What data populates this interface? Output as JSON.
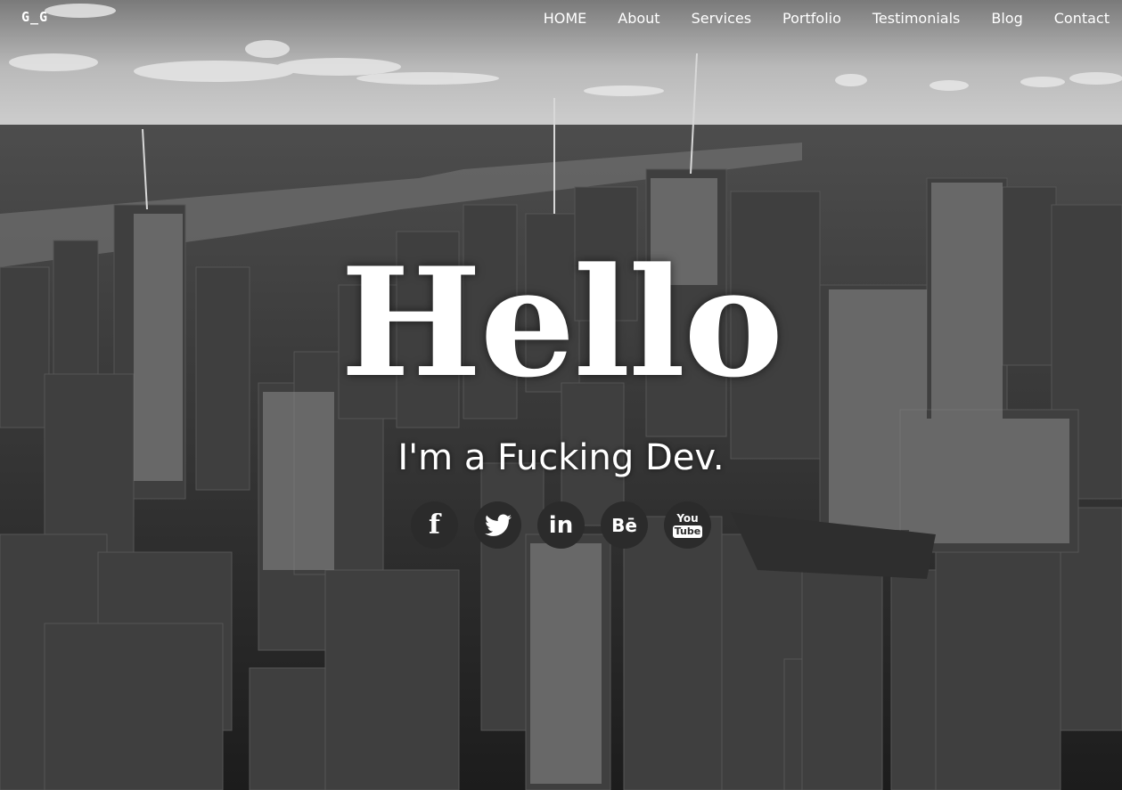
{
  "brand": {
    "logo_text": "G_G"
  },
  "nav": {
    "items": [
      {
        "label": "HOME"
      },
      {
        "label": "About"
      },
      {
        "label": "Services"
      },
      {
        "label": "Portfolio"
      },
      {
        "label": "Testimonials"
      },
      {
        "label": "Blog"
      },
      {
        "label": "Contact"
      }
    ]
  },
  "hero": {
    "heading": "Hello",
    "tagline": "I'm a Fucking Dev."
  },
  "socials": [
    {
      "icon": "facebook-icon",
      "glyph": "f"
    },
    {
      "icon": "twitter-icon",
      "glyph": ""
    },
    {
      "icon": "linkedin-icon",
      "glyph": "in"
    },
    {
      "icon": "behance-icon",
      "glyph": "Bē"
    },
    {
      "icon": "youtube-icon",
      "glyph_top": "You",
      "glyph_bottom": "Tube"
    }
  ],
  "colors": {
    "text": "#ffffff",
    "social_bg": "#2b2b2b"
  }
}
